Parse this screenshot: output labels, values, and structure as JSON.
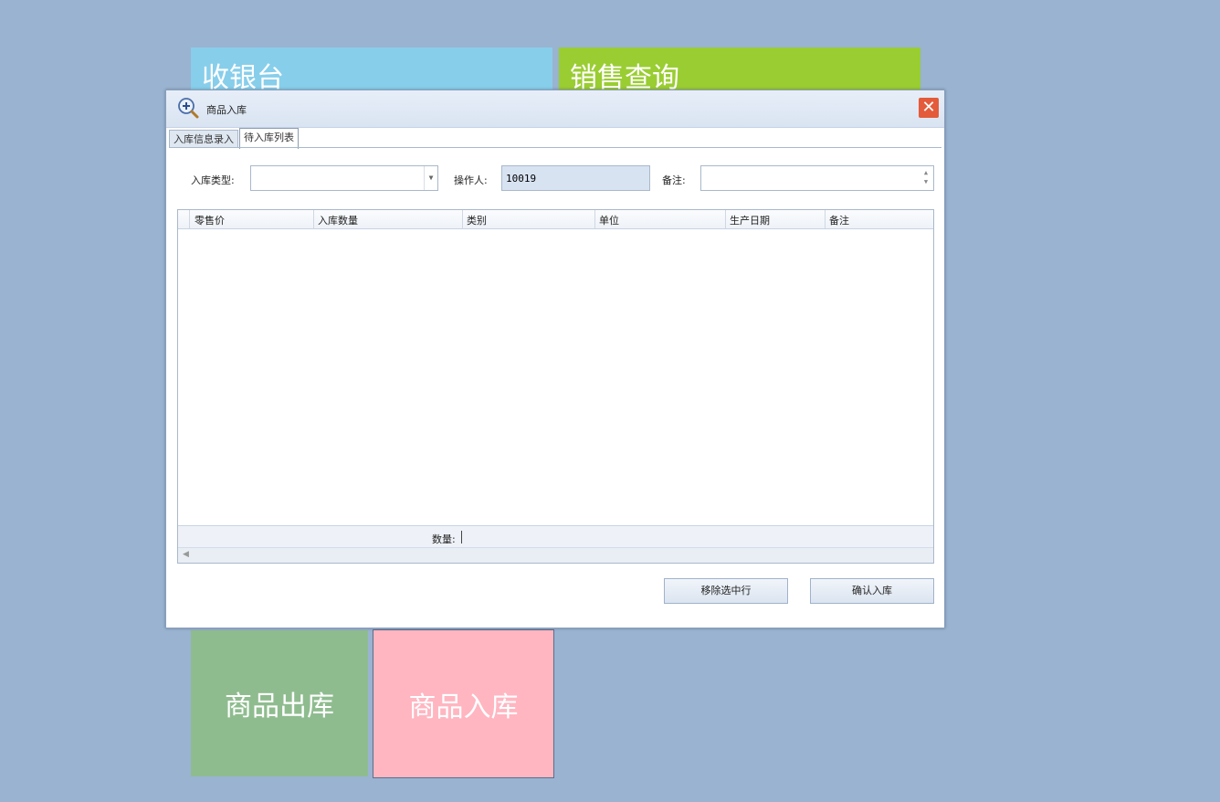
{
  "tiles": {
    "cashier": "收银台",
    "sales_query": "销售查询",
    "stock_out": "商品出库",
    "stock_in": "商品入库"
  },
  "dialog": {
    "title": "商品入库",
    "close_icon": "close-icon",
    "tabs": [
      "入库信息录入",
      "待入库列表"
    ],
    "active_tab": "待入库列表",
    "form": {
      "type_label": "入库类型:",
      "type_value": "",
      "operator_label": "操作人:",
      "operator_value": "10019",
      "remark_label": "备注:",
      "remark_value": ""
    },
    "grid": {
      "columns": [
        "零售价",
        "入库数量",
        "类别",
        "单位",
        "生产日期",
        "备注"
      ],
      "rows": [],
      "footer_label": "数量:"
    },
    "buttons": {
      "remove_selected": "移除选中行",
      "confirm": "确认入库"
    }
  },
  "colors": {
    "background": "#99b3d1",
    "cashier_tile": "#87ceeb",
    "sales_tile": "#9acd32",
    "stock_out_tile": "#8fbc8f",
    "stock_in_tile": "#ffb6c1",
    "close_button": "#e35b3a"
  }
}
